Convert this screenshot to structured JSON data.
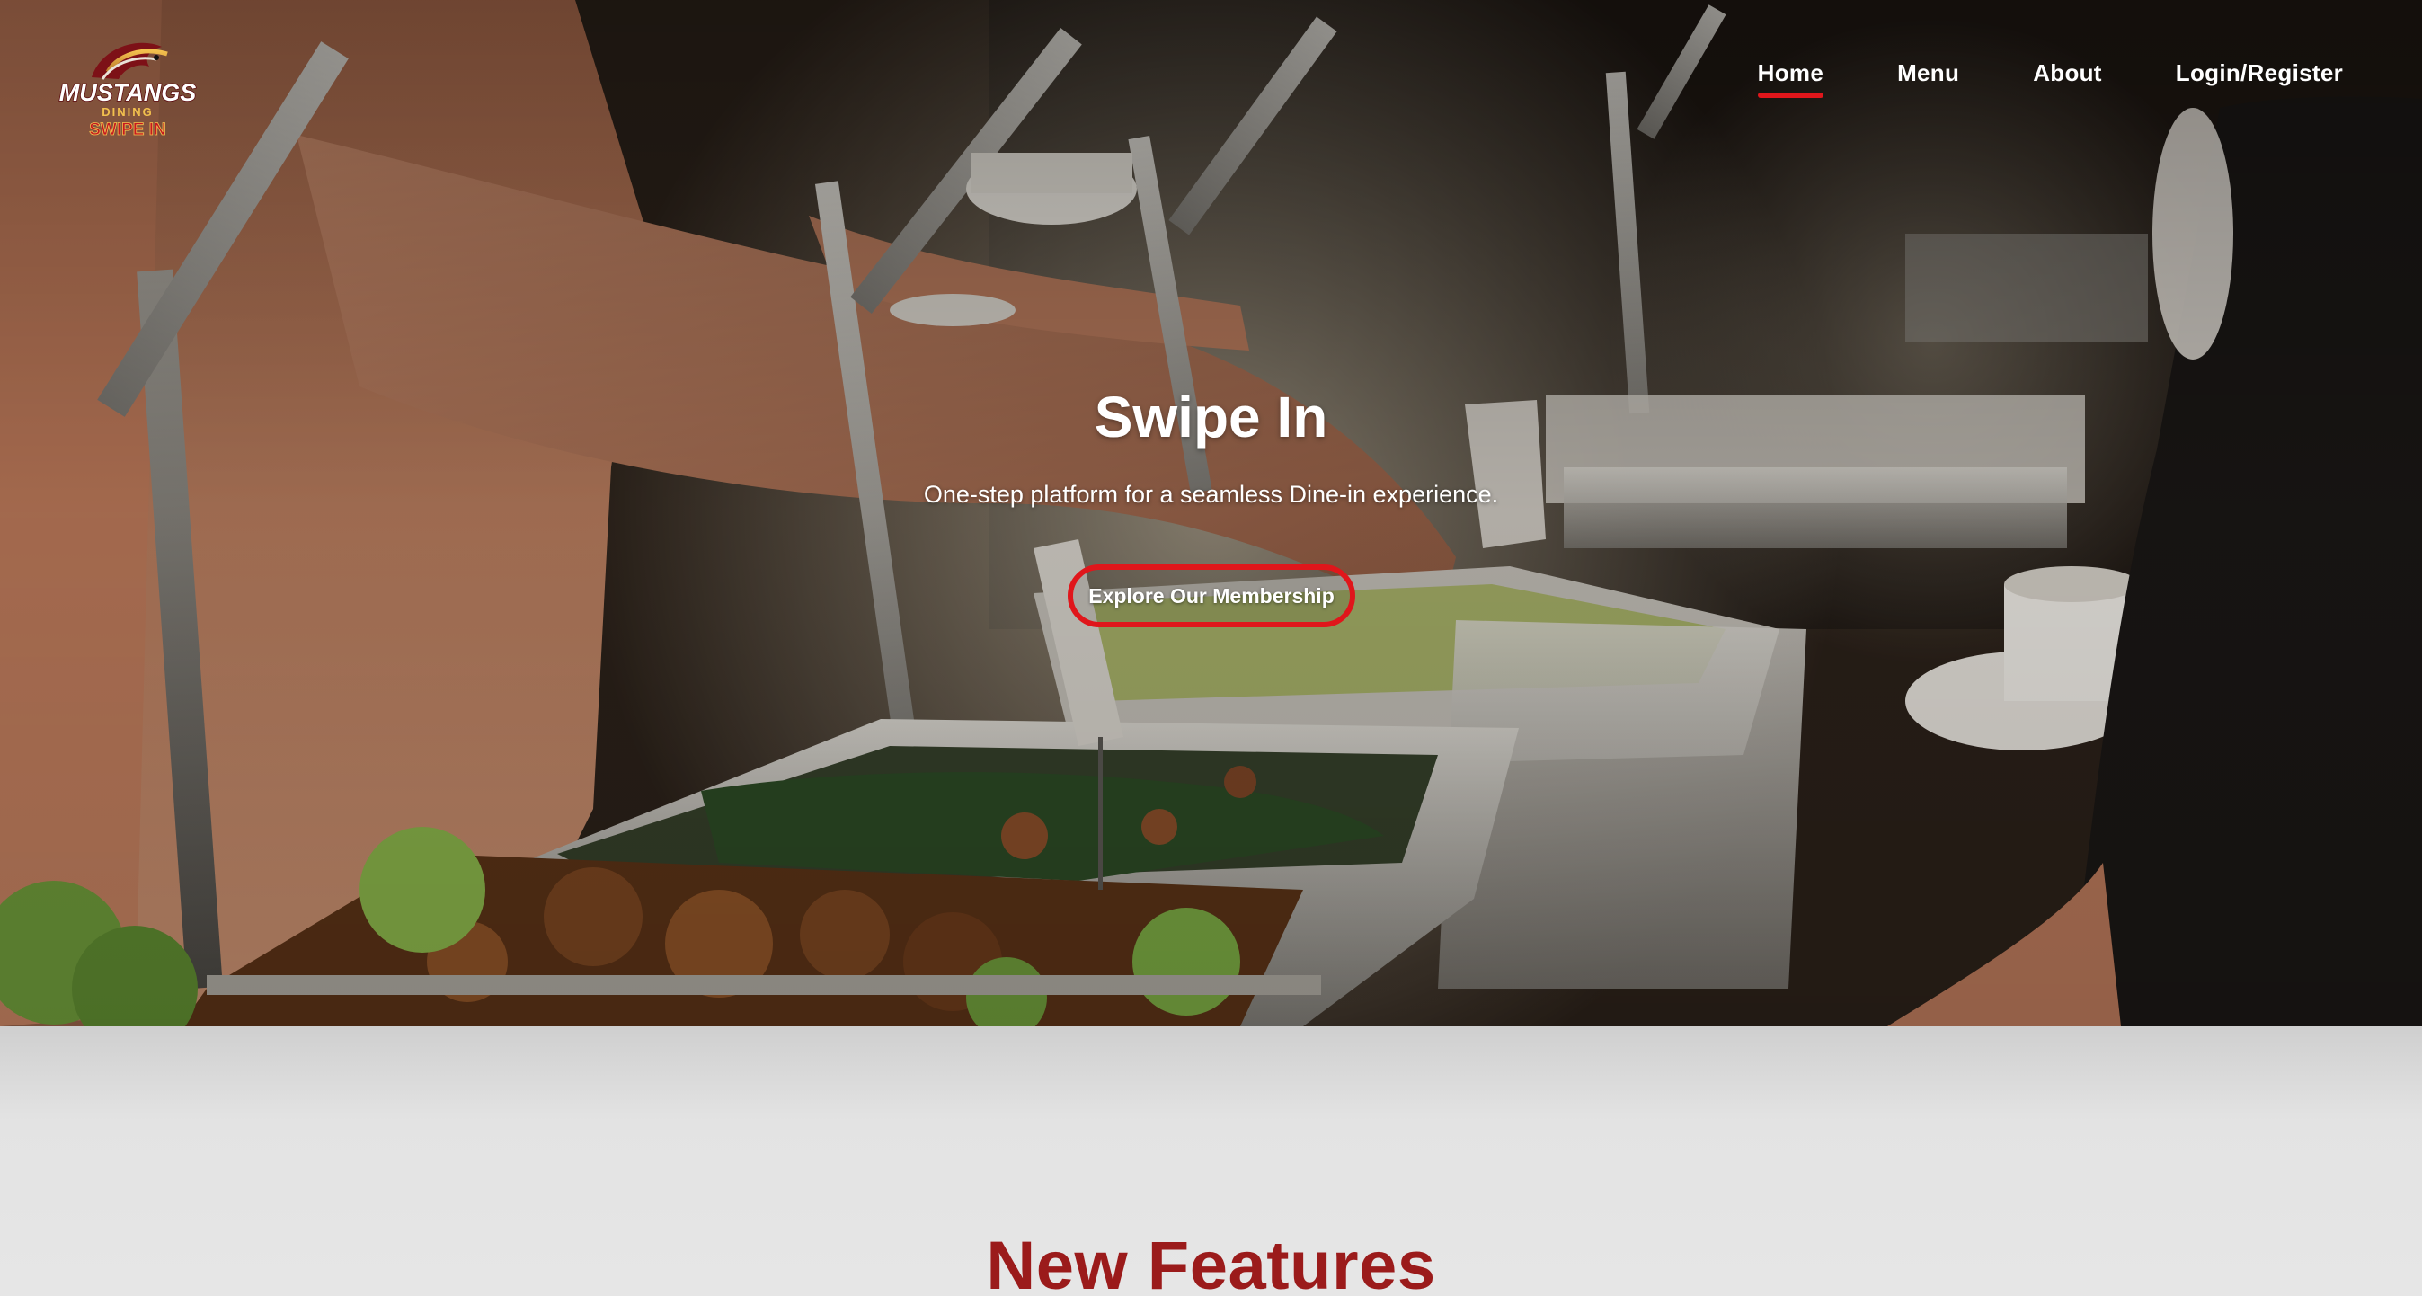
{
  "brand": {
    "logo_top": "MUSTANGS",
    "logo_middle": "DINING",
    "logo_bottom": "SWIPE IN"
  },
  "nav": {
    "items": [
      {
        "label": "Home",
        "active": true
      },
      {
        "label": "Menu",
        "active": false
      },
      {
        "label": "About",
        "active": false
      },
      {
        "label": "Login/Register",
        "active": false
      }
    ]
  },
  "hero": {
    "title": "Swipe In",
    "subtitle": "One-step platform for a seamless Dine-in experience.",
    "cta_label": "Explore Our Membership"
  },
  "features": {
    "title": "New Features"
  },
  "colors": {
    "accent_red": "#e0161b",
    "features_title": "#9b1b1b"
  }
}
